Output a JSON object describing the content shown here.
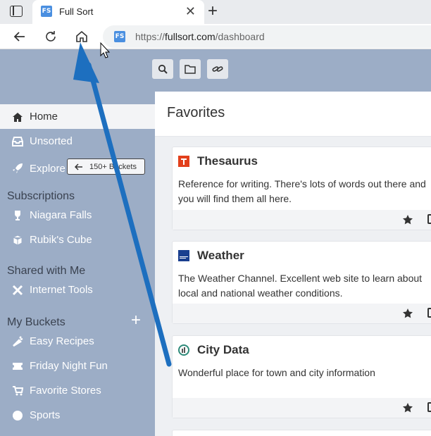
{
  "browser": {
    "tab_title": "Full Sort",
    "favicon_text": "FS",
    "url_prefix": "https://",
    "url_domain": "fullsort.com",
    "url_path": "/dashboard"
  },
  "sidebar": {
    "main_items": [
      {
        "label": "Home",
        "icon": "home-icon"
      },
      {
        "label": "Unsorted",
        "icon": "inbox-icon"
      },
      {
        "label": "Explore",
        "icon": "rocket-icon"
      }
    ],
    "explore_badge": "150+ Buckets",
    "subscriptions_title": "Subscriptions",
    "subscriptions": [
      {
        "label": "Niagara Falls",
        "icon": "trophy-icon"
      },
      {
        "label": "Rubik's Cube",
        "icon": "cube-icon"
      }
    ],
    "shared_title": "Shared with Me",
    "shared": [
      {
        "label": "Internet Tools",
        "icon": "tools-icon"
      }
    ],
    "my_buckets_title": "My Buckets",
    "my_buckets": [
      {
        "label": "Easy Recipes",
        "icon": "carrot-icon"
      },
      {
        "label": "Friday Night Fun",
        "icon": "ticket-icon"
      },
      {
        "label": "Favorite Stores",
        "icon": "cart-icon"
      },
      {
        "label": "Sports",
        "icon": "ball-icon"
      }
    ]
  },
  "main": {
    "title": "Favorites",
    "cards": [
      {
        "title": "Thesaurus",
        "description": "Reference for writing. There's lots of words out there and you will find them all here.",
        "icon": "thesaurus-logo-icon",
        "icon_color": "#e2401c"
      },
      {
        "title": "Weather",
        "description": "The Weather Channel. Excellent web site to learn about local and national weather conditions.",
        "icon": "weather-channel-logo-icon",
        "icon_color": "#1a3f8f"
      },
      {
        "title": "City Data",
        "description": "Wonderful place for town and city information",
        "icon": "city-data-logo-icon",
        "icon_color": "#2e8b7a"
      }
    ]
  },
  "colors": {
    "sidebar_bg": "#9cadc6",
    "arrow": "#1d6fbf"
  }
}
